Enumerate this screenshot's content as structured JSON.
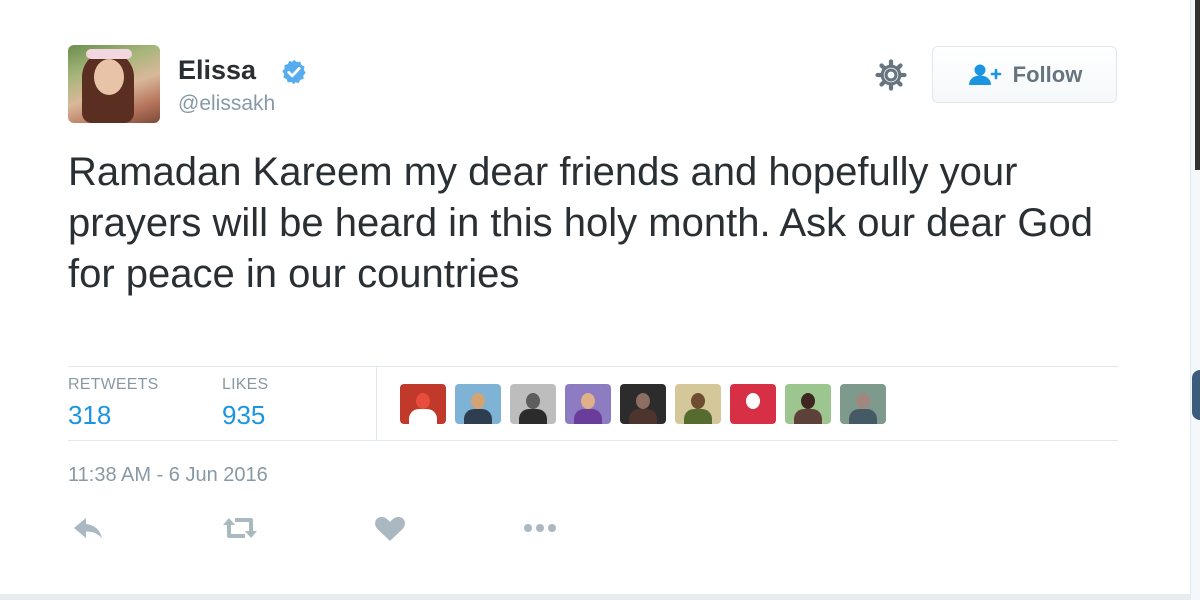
{
  "user": {
    "name": "Elissa",
    "handle": "@elissakh"
  },
  "follow": {
    "label": "Follow"
  },
  "tweet": {
    "text": "Ramadan Kareem my dear friends and hopefully your prayers will be heard in this holy month. Ask our dear God for peace in our countries",
    "timestamp": "11:38 AM - 6 Jun 2016"
  },
  "stats": {
    "retweets_label": "RETWEETS",
    "retweets": "318",
    "likes_label": "LIKES",
    "likes": "935"
  },
  "likers": [
    {
      "bg": "#c0392b",
      "head": "#e74c3c",
      "body": "#ffffff"
    },
    {
      "bg": "#7fb3d5",
      "head": "#d4a373",
      "body": "#2c3e50"
    },
    {
      "bg": "#bdbdbd",
      "head": "#5d5d5d",
      "body": "#2b2b2b"
    },
    {
      "bg": "#8e7cc3",
      "head": "#e0b08a",
      "body": "#6a3d9a"
    },
    {
      "bg": "#2c2c2c",
      "head": "#8d6e63",
      "body": "#4e342e"
    },
    {
      "bg": "#d4c89a",
      "head": "#6d4c2f",
      "body": "#556b2f"
    },
    {
      "bg": "#d62f46",
      "head": "#ffffff",
      "body": "#d62f46"
    },
    {
      "bg": "#9cc58f",
      "head": "#3e2723",
      "body": "#5d4037"
    },
    {
      "bg": "#7d9a8c",
      "head": "#a1887f",
      "body": "#455a64"
    }
  ],
  "actions": [
    {
      "name": "reply-icon"
    },
    {
      "name": "retweet-icon"
    },
    {
      "name": "like-icon"
    },
    {
      "name": "more-icon"
    }
  ],
  "colors": {
    "accent": "#1b95e0",
    "verified": "#55acee",
    "muted": "#8899a6",
    "icon": "#aab8c2"
  }
}
